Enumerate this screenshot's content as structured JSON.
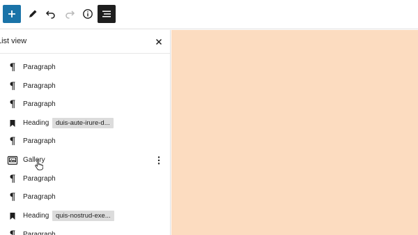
{
  "panel": {
    "title": "List view",
    "items": [
      {
        "type": "Paragraph",
        "anchor": ""
      },
      {
        "type": "Paragraph",
        "anchor": ""
      },
      {
        "type": "Paragraph",
        "anchor": ""
      },
      {
        "type": "Heading",
        "anchor": "duis-aute-irure-d..."
      },
      {
        "type": "Paragraph",
        "anchor": ""
      },
      {
        "type": "Gallery",
        "anchor": ""
      },
      {
        "type": "Paragraph",
        "anchor": ""
      },
      {
        "type": "Paragraph",
        "anchor": ""
      },
      {
        "type": "Heading",
        "anchor": "quis-nostrud-exe..."
      },
      {
        "type": "Paragraph",
        "anchor": ""
      }
    ]
  },
  "icons": {
    "add": "plus-icon",
    "tools": "pencil-icon",
    "undo": "undo-icon",
    "redo": "redo-icon",
    "details": "info-icon",
    "list_view": "list-view-icon",
    "close": "close-icon",
    "paragraph": "pilcrow-icon",
    "heading": "bookmark-icon",
    "gallery": "gallery-icon",
    "options": "more-vertical-icon"
  },
  "colors": {
    "accent": "#1a73a8",
    "active_button": "#1e1e1e",
    "canvas_background": "#fcdcc0"
  }
}
